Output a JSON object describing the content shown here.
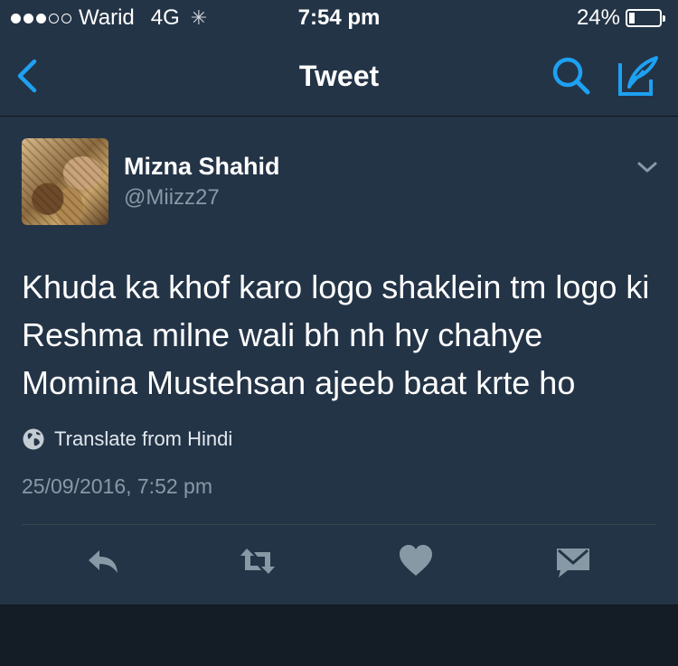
{
  "status_bar": {
    "carrier": "Warid",
    "network": "4G",
    "time": "7:54 pm",
    "battery": "24%",
    "battery_level": 0.24,
    "signal_bars_filled": 3,
    "signal_bars_total": 5
  },
  "nav": {
    "title": "Tweet",
    "back_icon": "chevron-left-icon",
    "search_icon": "search-icon",
    "compose_icon": "compose-tweet-icon"
  },
  "tweet": {
    "author_name": "Mizna Shahid",
    "author_handle": "@Miizz27",
    "text": "Khuda ka khof karo logo shaklein tm logo ki Reshma milne wali bh nh hy chahye Momina Mustehsan ajeeb baat krte ho",
    "translate_label": "Translate from Hindi",
    "timestamp": "25/09/2016, 7:52 pm"
  },
  "actions": {
    "reply_icon": "reply-icon",
    "retweet_icon": "retweet-icon",
    "like_icon": "heart-icon",
    "dm_icon": "direct-message-icon"
  },
  "colors": {
    "background": "#141d26",
    "surface": "#243447",
    "accent": "#1da1f2",
    "secondary_text": "#8899a6",
    "icon_gray": "#8899a6"
  }
}
